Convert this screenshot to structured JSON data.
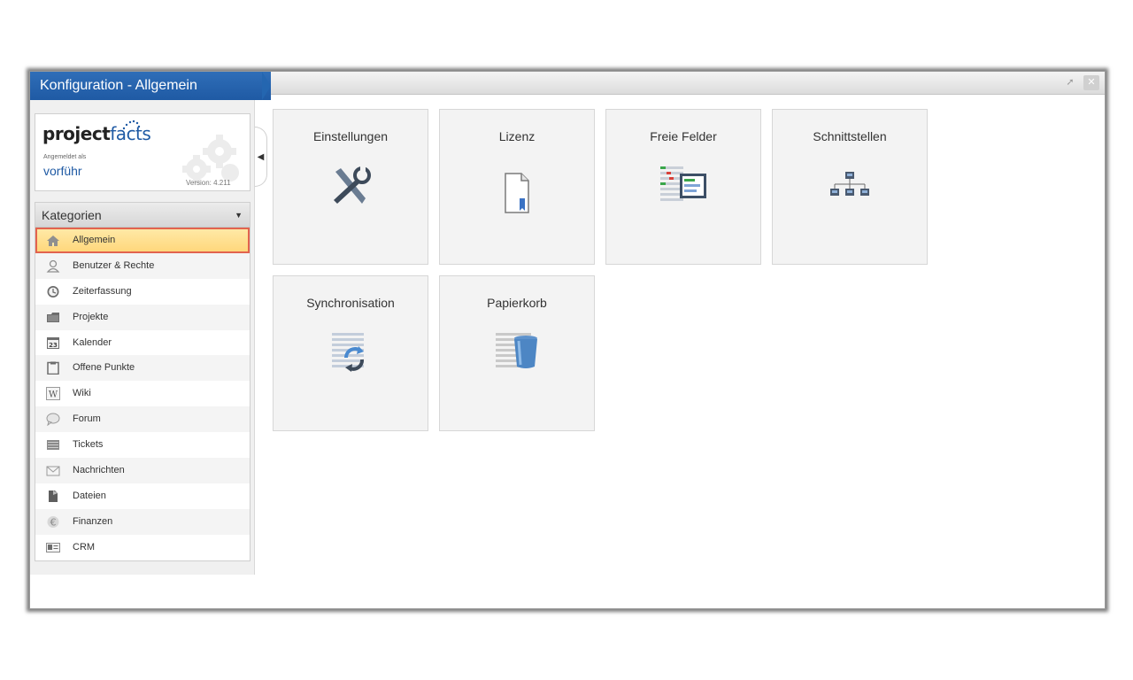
{
  "window": {
    "title": "Konfiguration - Allgemein"
  },
  "user_box": {
    "logo_part1": "project",
    "logo_part2": "facts",
    "logged_in_label": "Angemeldet als",
    "username": "vorführ",
    "version": "Version: 4.211"
  },
  "categories": {
    "header": "Kategorien",
    "items": [
      {
        "label": "Allgemein",
        "icon": "home-icon",
        "selected": true
      },
      {
        "label": "Benutzer & Rechte",
        "icon": "user-icon"
      },
      {
        "label": "Zeiterfassung",
        "icon": "clock-icon"
      },
      {
        "label": "Projekte",
        "icon": "folder-icon"
      },
      {
        "label": "Kalender",
        "icon": "calendar-icon",
        "badge": "23"
      },
      {
        "label": "Offene Punkte",
        "icon": "clipboard-icon"
      },
      {
        "label": "Wiki",
        "icon": "wiki-icon",
        "badge": "W"
      },
      {
        "label": "Forum",
        "icon": "speech-bubble-icon"
      },
      {
        "label": "Tickets",
        "icon": "ticket-icon"
      },
      {
        "label": "Nachrichten",
        "icon": "envelope-icon"
      },
      {
        "label": "Dateien",
        "icon": "file-icon"
      },
      {
        "label": "Finanzen",
        "icon": "euro-icon"
      },
      {
        "label": "CRM",
        "icon": "contact-card-icon"
      }
    ]
  },
  "tiles": [
    {
      "label": "Einstellungen",
      "icon": "tools-icon"
    },
    {
      "label": "Lizenz",
      "icon": "license-document-icon"
    },
    {
      "label": "Freie Felder",
      "icon": "form-fields-icon"
    },
    {
      "label": "Schnittstellen",
      "icon": "network-icon"
    },
    {
      "label": "Synchronisation",
      "icon": "sync-icon"
    },
    {
      "label": "Papierkorb",
      "icon": "trash-icon"
    }
  ],
  "colors": {
    "accent_blue": "#1f5aa4",
    "selected_fill": "#ffd77c",
    "selected_border": "#e2634e"
  }
}
